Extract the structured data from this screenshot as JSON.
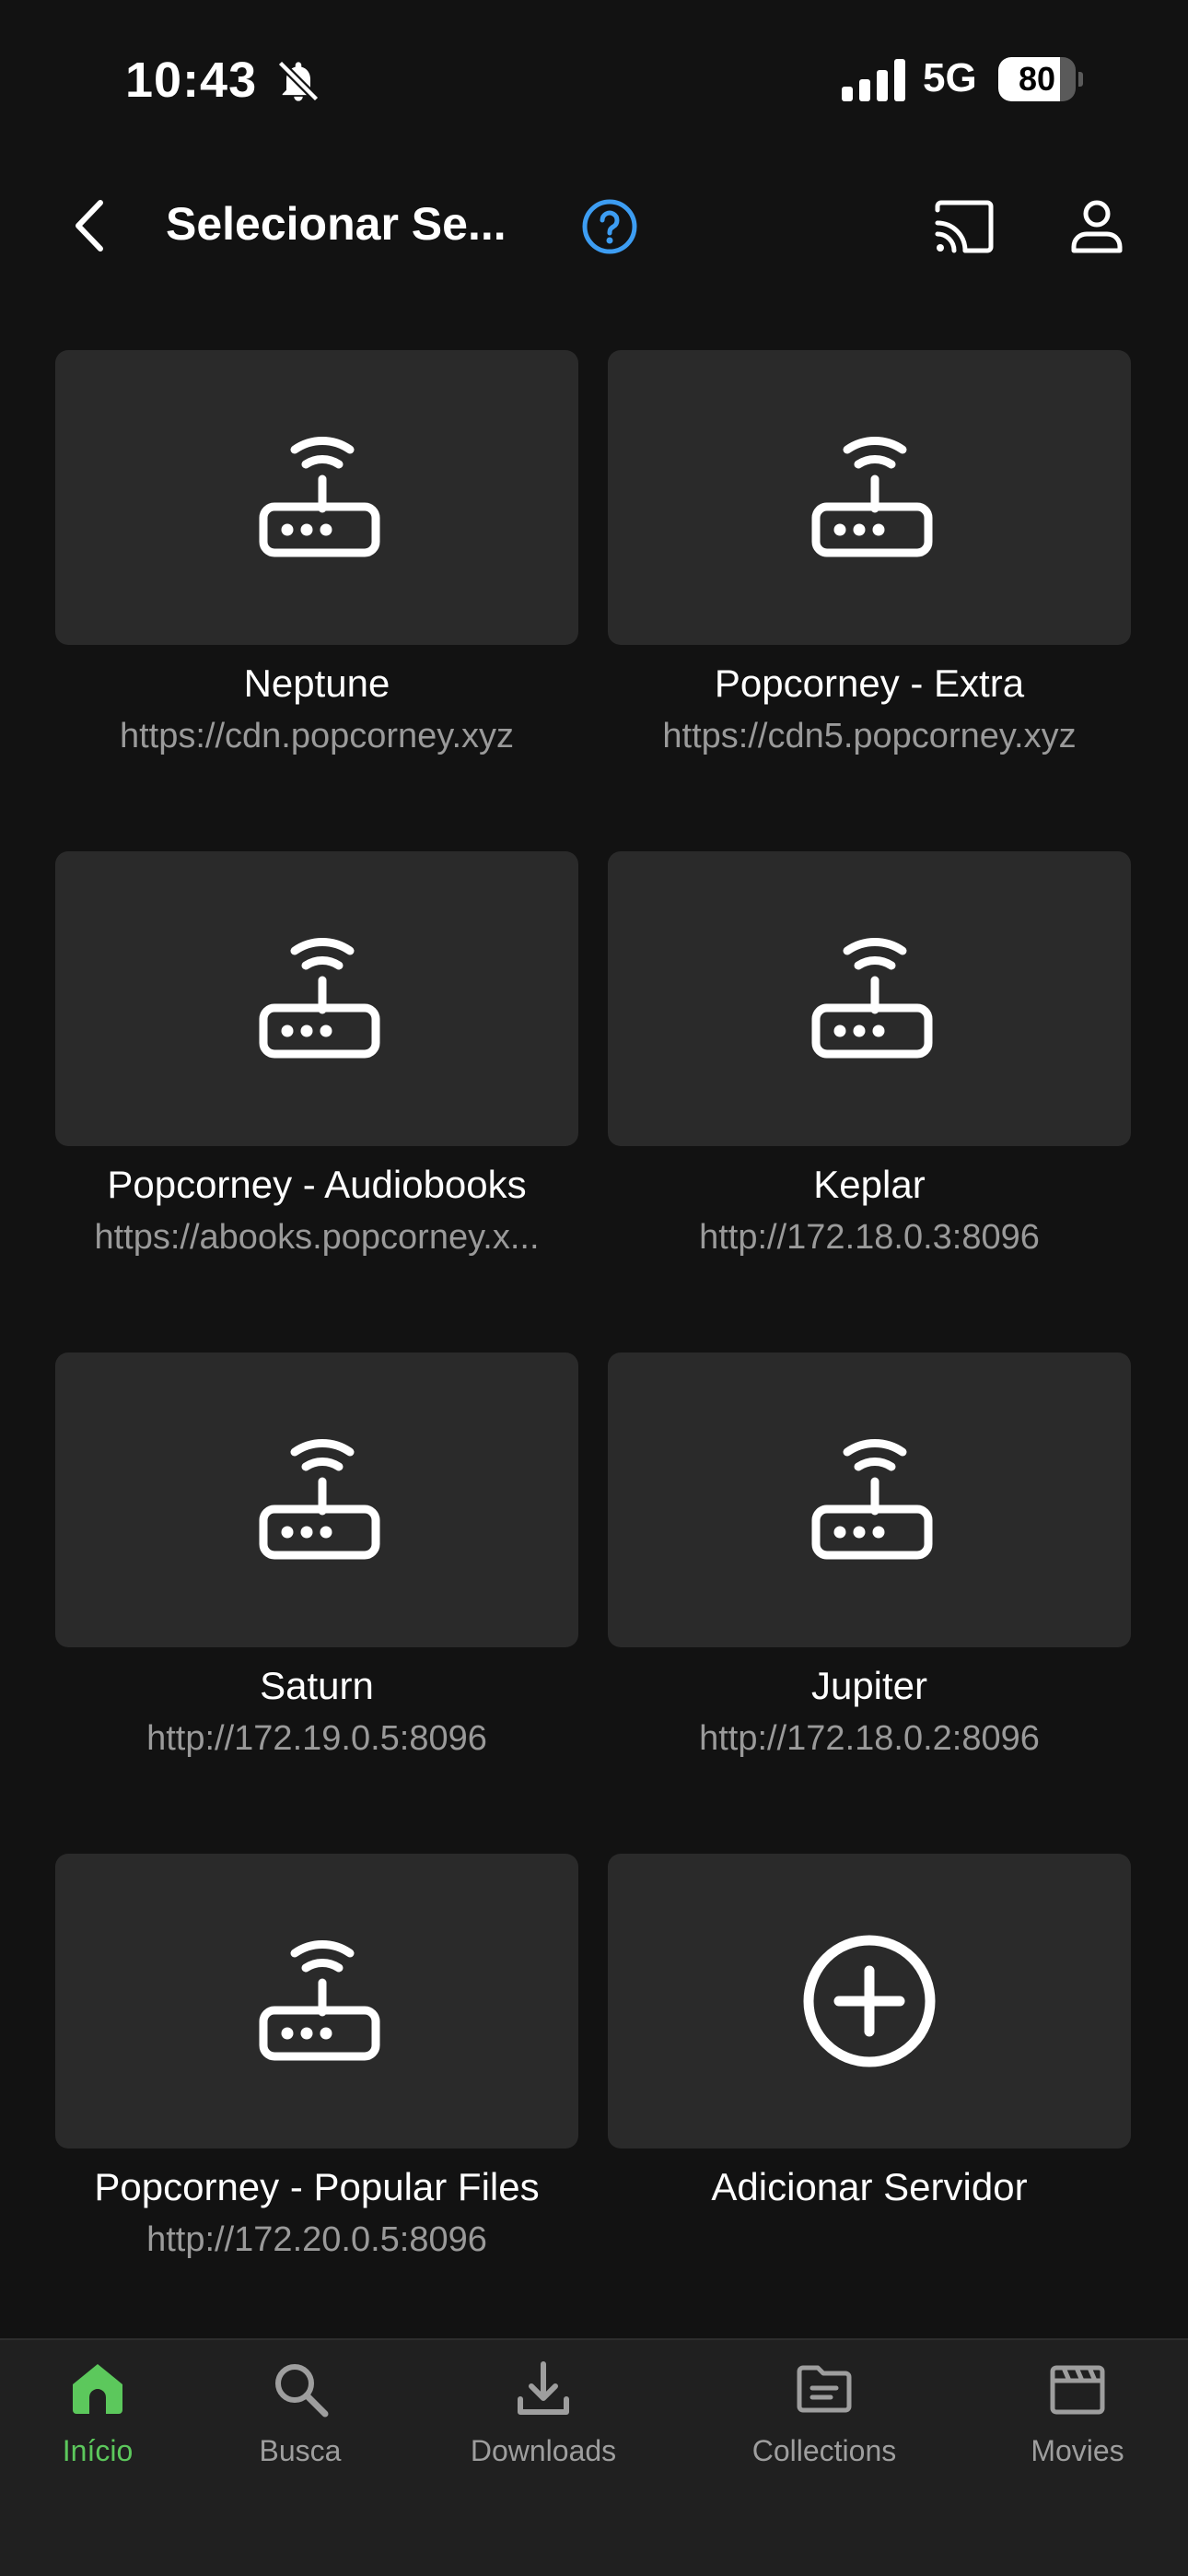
{
  "status_bar": {
    "time": "10:43",
    "network": "5G",
    "battery": "80",
    "battery_level": 0.8
  },
  "header": {
    "title": "Selecionar Se..."
  },
  "colors": {
    "background": "#121212",
    "card": "#2a2a2a",
    "accent_green": "#5cc85c",
    "help_blue": "#3d9df2",
    "muted_text": "#9a9a9a"
  },
  "servers": [
    {
      "name": "Neptune",
      "url": "https://cdn.popcorney.xyz",
      "icon": "router-icon"
    },
    {
      "name": "Popcorney - Extra",
      "url": "https://cdn5.popcorney.xyz",
      "icon": "router-icon"
    },
    {
      "name": "Popcorney - Audiobooks",
      "url": "https://abooks.popcorney.x...",
      "icon": "router-icon"
    },
    {
      "name": "Keplar",
      "url": "http://172.18.0.3:8096",
      "icon": "router-icon"
    },
    {
      "name": "Saturn",
      "url": "http://172.19.0.5:8096",
      "icon": "router-icon"
    },
    {
      "name": "Jupiter",
      "url": "http://172.18.0.2:8096",
      "icon": "router-icon"
    },
    {
      "name": "Popcorney - Popular Files",
      "url": "http://172.20.0.5:8096",
      "icon": "router-icon"
    }
  ],
  "add_server": {
    "label": "Adicionar Servidor",
    "icon": "add-circle-icon"
  },
  "bottom_nav": [
    {
      "label": "Início",
      "icon": "home-icon",
      "active": true
    },
    {
      "label": "Busca",
      "icon": "search-icon",
      "active": false
    },
    {
      "label": "Downloads",
      "icon": "download-icon",
      "active": false
    },
    {
      "label": "Collections",
      "icon": "folder-icon",
      "active": false
    },
    {
      "label": "Movies",
      "icon": "clapperboard-icon",
      "active": false
    }
  ]
}
